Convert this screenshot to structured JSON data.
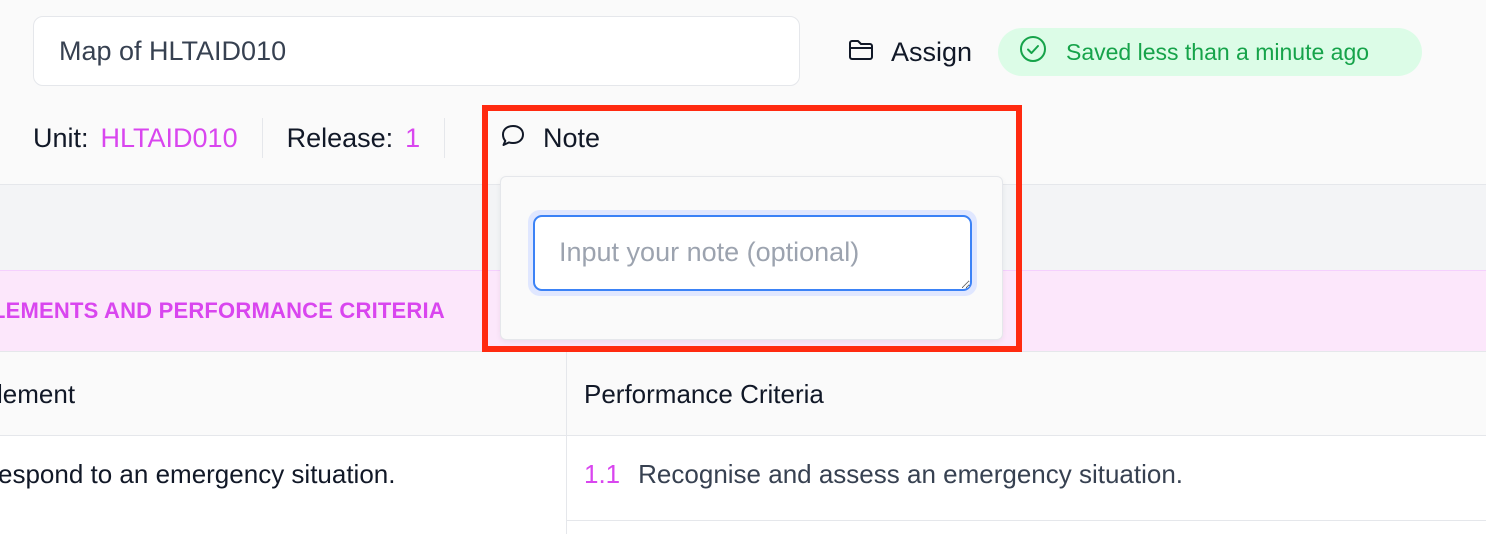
{
  "header": {
    "map_title": "Map of HLTAID010",
    "assign_label": "Assign",
    "saved_status": "Saved less than a minute ago"
  },
  "meta": {
    "unit_key": "Unit:",
    "unit_value": "HLTAID010",
    "release_key": "Release:",
    "release_value": "1",
    "note_label": "Note"
  },
  "note_popover": {
    "placeholder": "Input your note (optional)"
  },
  "section": {
    "criteria_title": "LEMENTS AND PERFORMANCE CRITERIA"
  },
  "table": {
    "columns": [
      "lement",
      "Performance Criteria"
    ],
    "rows": [
      {
        "element": "espond to an emergency situation.",
        "pc_number": "1.1",
        "pc_text": "Recognise and assess an emergency situation."
      }
    ]
  },
  "colors": {
    "accent": "#d946ef",
    "success": "#16a34a",
    "focus": "#3b82f6",
    "highlight": "#ff2a10"
  },
  "icons": {
    "assign": "folder-icon",
    "saved": "check-circle-icon",
    "note": "speech-bubble-icon"
  }
}
